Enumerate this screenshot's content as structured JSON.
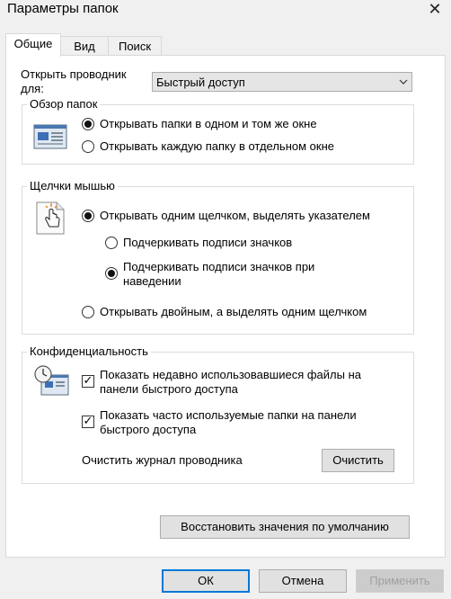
{
  "window": {
    "title": "Параметры папок",
    "close_glyph": "✕"
  },
  "tabs": [
    "Общие",
    "Вид",
    "Поиск"
  ],
  "open_explorer": {
    "label_line1": "Открыть проводник",
    "label_line2": "для:",
    "selected": "Быстрый доступ"
  },
  "browse_folders": {
    "title": "Обзор папок",
    "option_same_window": "Открывать папки в одном и том же окне",
    "option_new_window": "Открывать каждую папку в отдельном окне",
    "selected": "same_window"
  },
  "mouse_clicks": {
    "title": "Щелчки мышью",
    "option_single_click": "Открывать одним щелчком, выделять указателем",
    "sub_always_line1": "Подчеркивать подписи значков",
    "sub_hover_line1": "Подчеркивать подписи значков при",
    "sub_hover_line2": "наведении",
    "option_double_click": "Открывать двойным, а выделять одним щелчком",
    "selected": "single_click",
    "underline_selected": "on_hover"
  },
  "privacy": {
    "title": "Конфиденциальность",
    "recent_files_line1": "Показать недавно использовавшиеся файлы на",
    "recent_files_line2": "панели быстрого доступа",
    "recent_files_checked": true,
    "frequent_folders_line1": "Показать часто используемые папки на панели",
    "frequent_folders_line2": "быстрого доступа",
    "frequent_folders_checked": true,
    "clear_history_label": "Очистить журнал проводника",
    "clear_button": "Очистить",
    "check_glyph": "✓"
  },
  "restore_defaults_button": "Восстановить значения по умолчанию",
  "footer": {
    "ok": "ОК",
    "cancel": "Отмена",
    "apply": "Применить"
  }
}
